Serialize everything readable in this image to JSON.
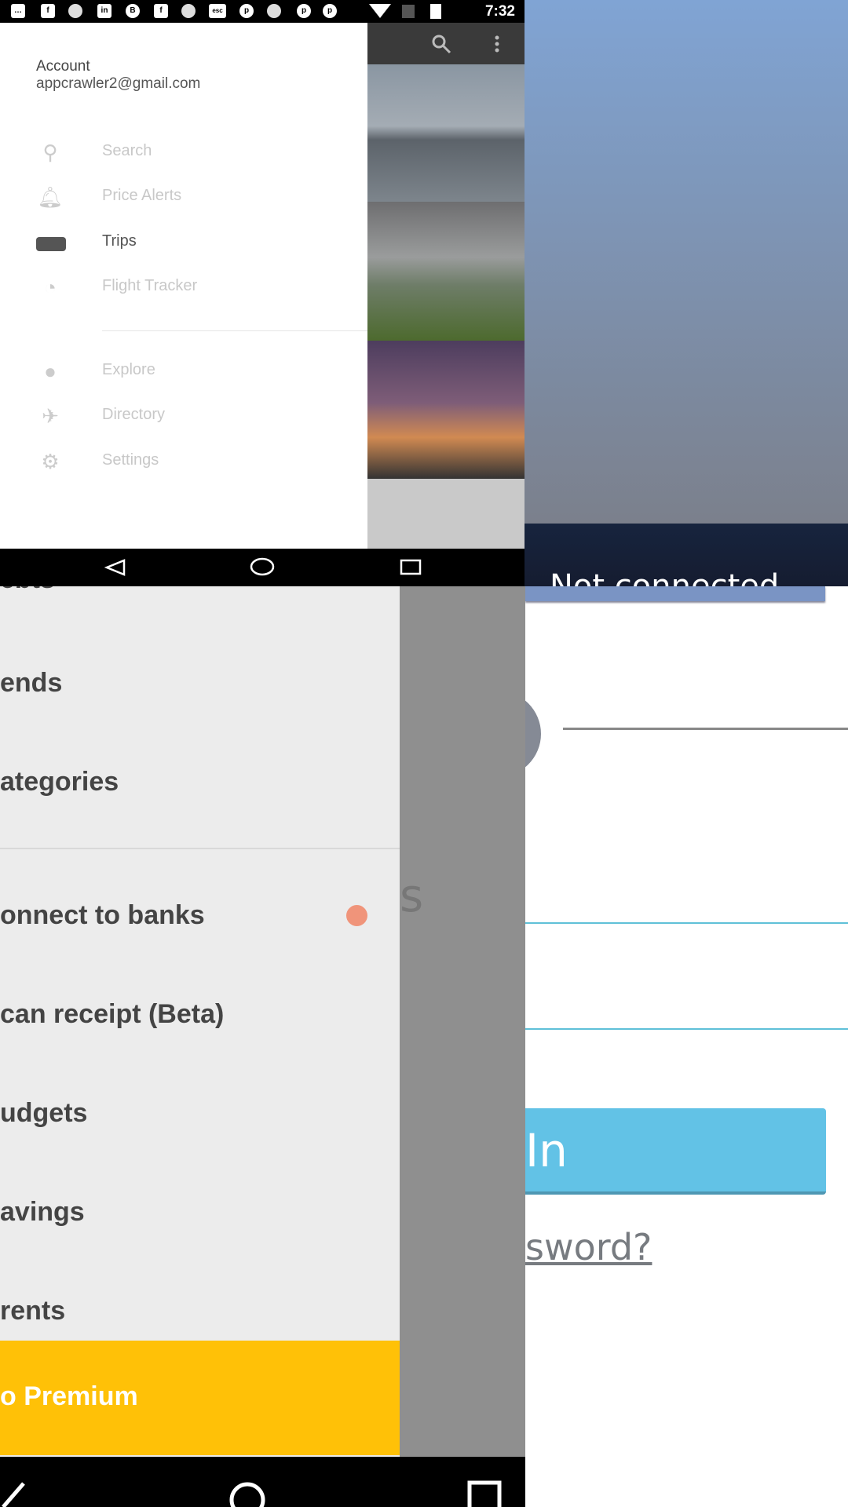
{
  "status_bar": {
    "time": "7:32",
    "notification_icons": [
      "more-icon",
      "facebook-icon",
      "cat-icon",
      "linkedin-icon",
      "b-icon",
      "facebook-icon",
      "cat-icon",
      "esc-icon",
      "pinterest-icon",
      "cat-icon",
      "pinterest-icon",
      "pinterest-icon"
    ],
    "esc_label": "esc"
  },
  "travel_drawer": {
    "account_label": "Account",
    "email": "appcrawler2@gmail.com",
    "items": [
      {
        "label": "Search",
        "icon": "search-icon"
      },
      {
        "label": "Price Alerts",
        "icon": "bell-icon"
      },
      {
        "label": "Trips",
        "icon": "briefcase-icon",
        "active": true
      },
      {
        "label": "Flight Tracker",
        "icon": "radar-icon"
      },
      {
        "label": "Explore",
        "icon": "compass-icon"
      },
      {
        "label": "Directory",
        "icon": "airport-icon"
      },
      {
        "label": "Settings",
        "icon": "gear-icon"
      }
    ]
  },
  "top_right": {
    "status_text": "Not connected"
  },
  "finance_drawer": {
    "items": [
      "ebts",
      "ends",
      "ategories",
      "onnect to banks",
      "can receipt (Beta)",
      "udgets",
      "avings",
      "rents"
    ],
    "premium_label": "o Premium",
    "overlay_text": "s",
    "colors": {
      "premium": "#ffc107",
      "badge": "#f0947a"
    }
  },
  "login": {
    "sign_in_label": "In",
    "forgot_label": "sword?",
    "accent": "#62c2e6"
  }
}
